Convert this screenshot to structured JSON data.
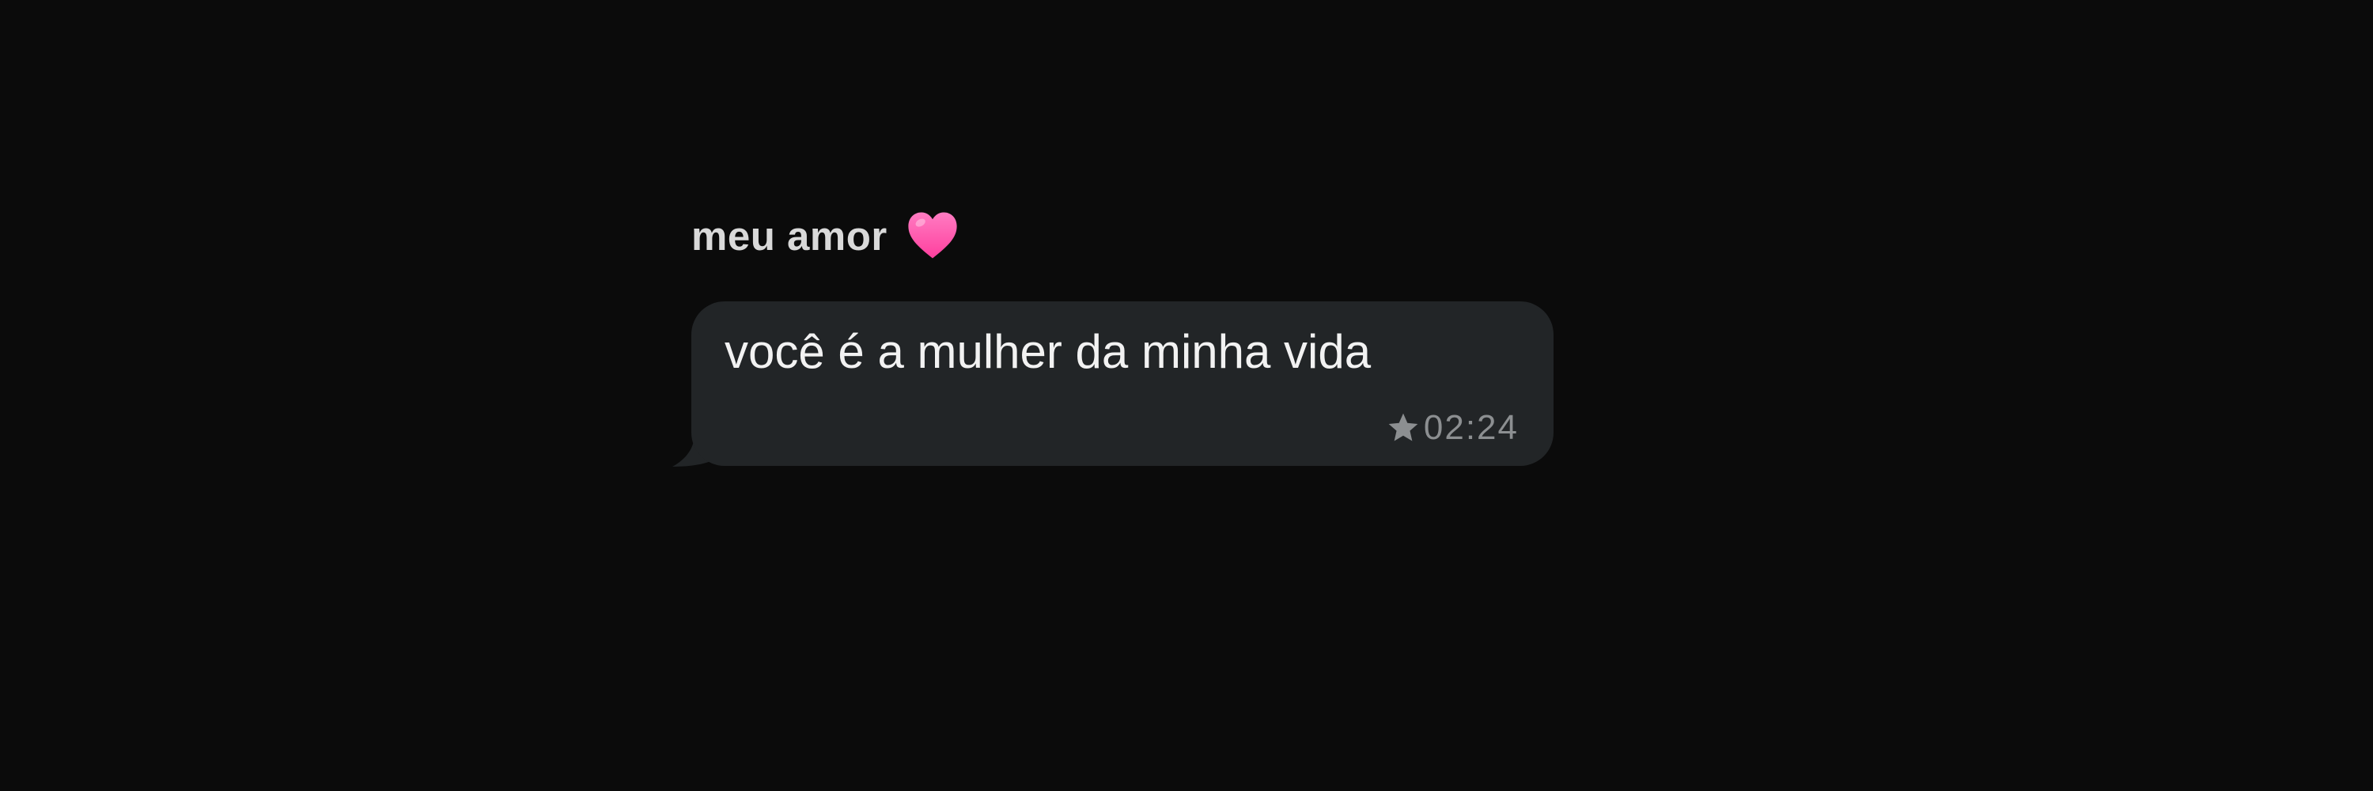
{
  "chat": {
    "sender": {
      "name": "meu amor",
      "emoji_icon": "pink-heart-icon"
    },
    "message": {
      "text": "você é a mulher da minha vida",
      "time": "02:24",
      "starred": true,
      "status_icon": "star-icon"
    }
  },
  "colors": {
    "background": "#0b0b0b",
    "bubble": "#222527",
    "message_text": "#f2f2f2",
    "sender_name": "#d9d9d9",
    "meta_text": "#8c8f91",
    "heart": "#ff4fa8"
  }
}
